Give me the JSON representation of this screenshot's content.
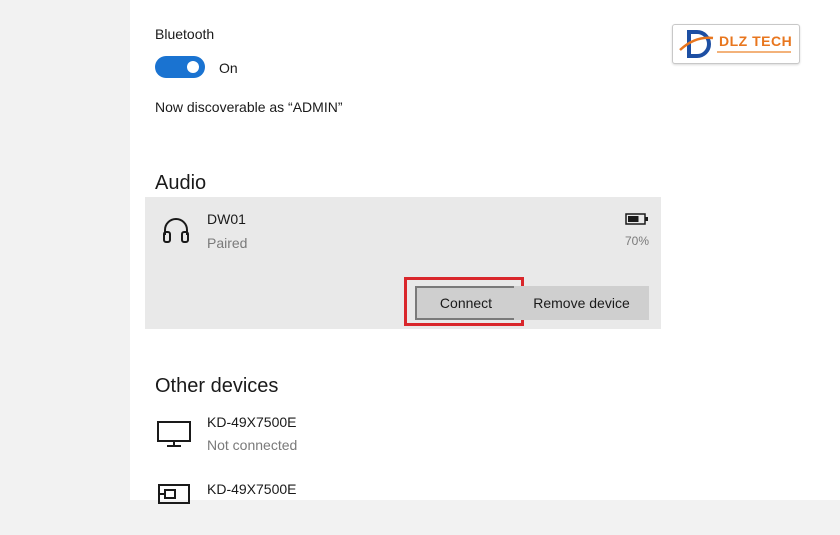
{
  "bluetooth": {
    "label": "Bluetooth",
    "toggle_state": "On",
    "discoverable": "Now discoverable as “ADMIN”"
  },
  "audio": {
    "section_title": "Audio",
    "device": {
      "name": "DW01",
      "status": "Paired",
      "battery": "70%",
      "battery_level": 0.7,
      "icon": "headphones-icon"
    },
    "connect_label": "Connect",
    "remove_label": "Remove device"
  },
  "other_devices": {
    "section_title": "Other devices",
    "items": [
      {
        "name": "KD-49X7500E",
        "status": "Not connected",
        "icon": "monitor-icon"
      },
      {
        "name": "KD-49X7500E",
        "status": "",
        "icon": "media-device-icon"
      }
    ]
  },
  "watermark": {
    "brand": "DLZ TECH"
  },
  "colors": {
    "toggle_on": "#1a73d1",
    "highlight": "#d9262b",
    "logo_orange": "#e8761e",
    "logo_blue": "#1d4fa3"
  }
}
